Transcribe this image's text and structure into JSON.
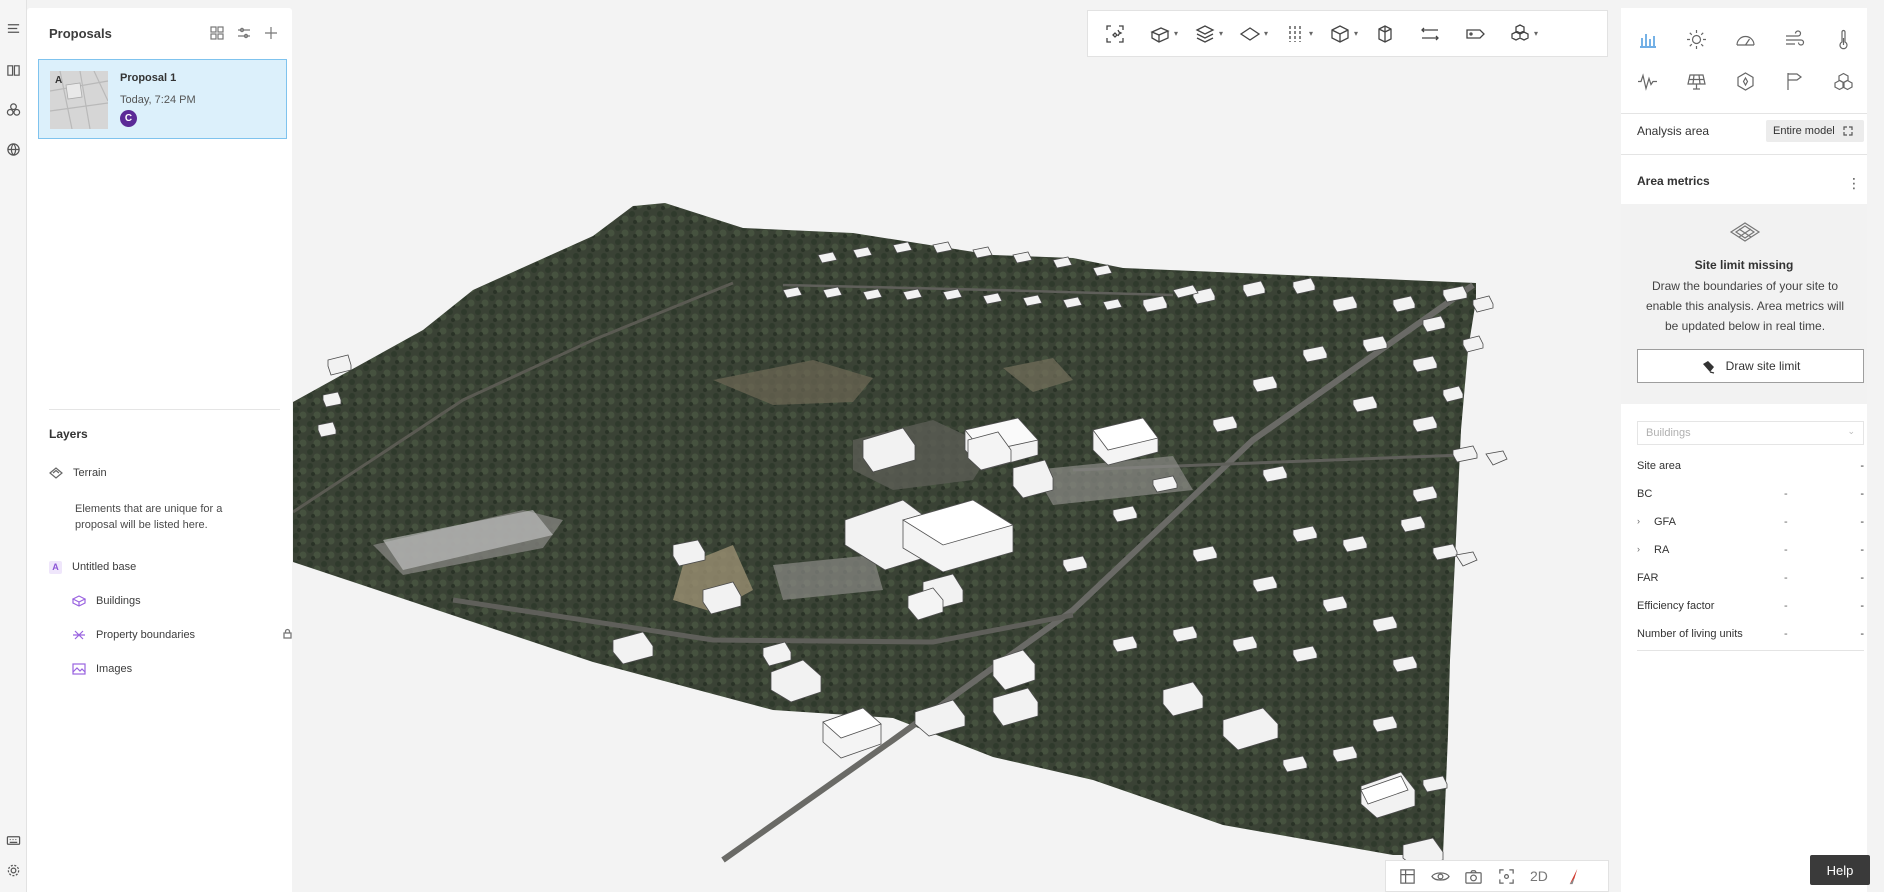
{
  "rail": {
    "icons": [
      "menu-icon",
      "book-icon",
      "cluster-icon",
      "globe-icon",
      "keyboard-icon",
      "settings-icon"
    ]
  },
  "proposals": {
    "title": "Proposals",
    "items": [
      {
        "thumbnail_letter": "A",
        "title": "Proposal 1",
        "date": "Today, 7:24 PM",
        "avatar": "C"
      }
    ]
  },
  "layers": {
    "title": "Layers",
    "terrain": "Terrain",
    "note": "Elements that are unique for a proposal will be listed here.",
    "base": {
      "letter": "A",
      "label": "Untitled base"
    },
    "children": [
      {
        "label": "Buildings",
        "icon": "buildings-layer-icon"
      },
      {
        "label": "Property boundaries",
        "icon": "boundaries-layer-icon",
        "locked": true
      },
      {
        "label": "Images",
        "icon": "images-layer-icon"
      }
    ]
  },
  "toolbar": {
    "tools": [
      "magic-draw-icon",
      "building-tool-icon",
      "stacked-floors-icon",
      "area-tool-icon",
      "divider-tool-icon",
      "box-tool-icon",
      "object-tool-icon",
      "measure-icon",
      "label-icon",
      "components-icon"
    ]
  },
  "bottombar": {
    "view_2d_label": "2D"
  },
  "analysis": {
    "icons": [
      "chart-icon",
      "sun-icon",
      "daylight-icon",
      "wind-icon",
      "thermometer-icon",
      "noise-icon",
      "solar-panel-icon",
      "hexagon-icon",
      "flag-icon",
      "stack-icon"
    ],
    "area_label": "Analysis area",
    "area_value": "Entire model",
    "metrics_title": "Area metrics",
    "missing_title": "Site limit missing",
    "missing_text": "Draw the boundaries of your site to enable this analysis. Area metrics will be updated below in real time.",
    "draw_button": "Draw site limit",
    "select_placeholder": "Buildings",
    "rows": [
      {
        "label": "Site area",
        "v1": "",
        "v2": "-"
      },
      {
        "label": "BC",
        "v1": "-",
        "v2": "-"
      },
      {
        "label": "GFA",
        "v1": "-",
        "v2": "-",
        "expandable": true
      },
      {
        "label": "RA",
        "v1": "-",
        "v2": "-",
        "expandable": true
      },
      {
        "label": "FAR",
        "v1": "-",
        "v2": "-"
      },
      {
        "label": "Efficiency factor",
        "v1": "-",
        "v2": "-"
      },
      {
        "label": "Number of living units",
        "v1": "-",
        "v2": "-"
      }
    ]
  },
  "help": {
    "label": "Help"
  },
  "colors": {
    "accent": "#1b7ed6",
    "selected_bg": "#dcf0fb",
    "avatar": "#5b2a97",
    "terrain": "#3a4235"
  }
}
